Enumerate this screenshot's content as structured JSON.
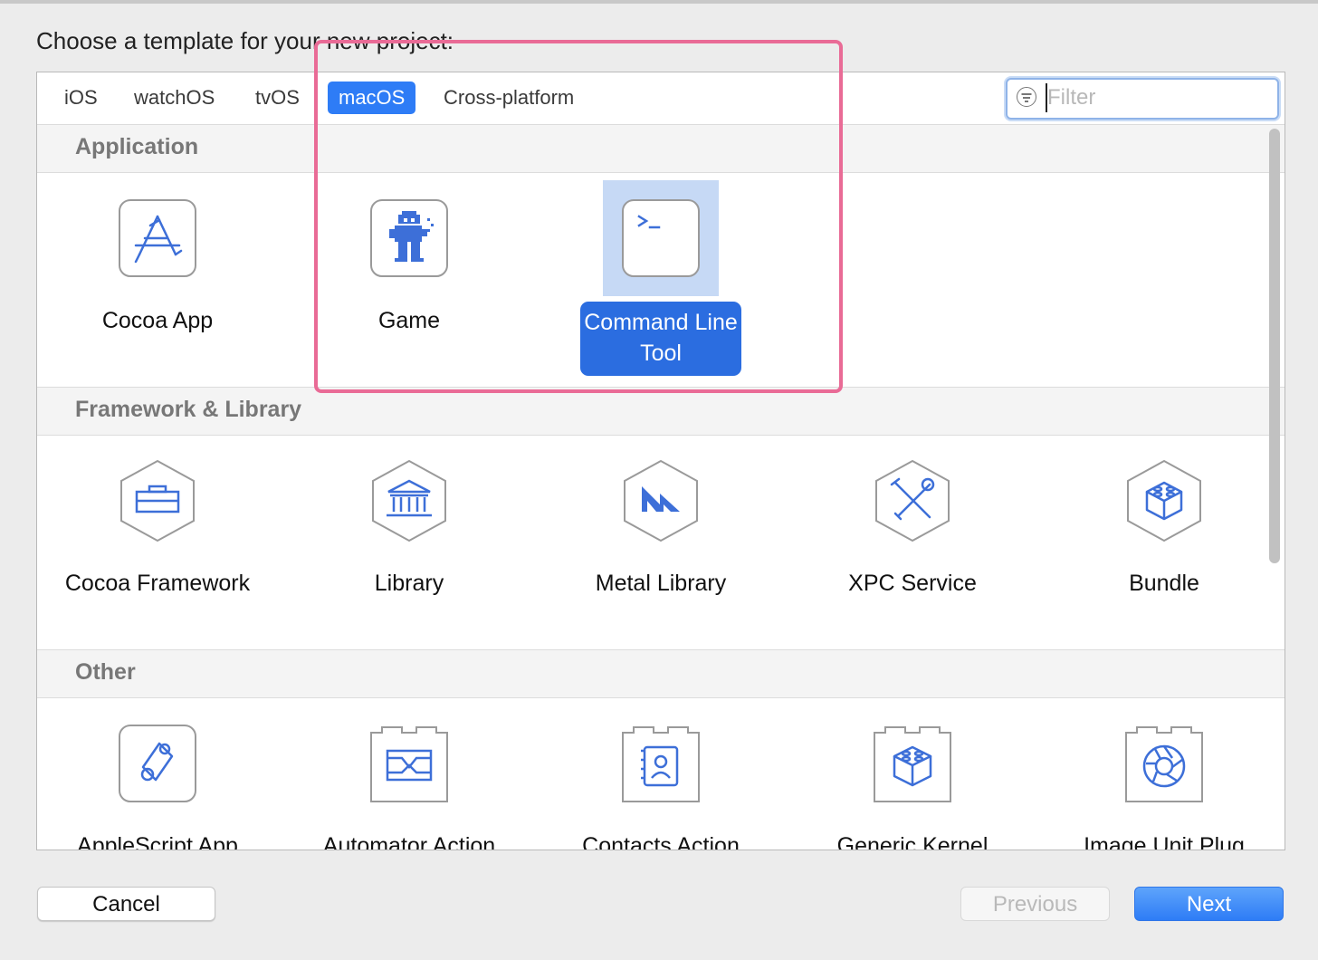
{
  "dialog": {
    "heading": "Choose a template for your new project:"
  },
  "tabs": [
    {
      "label": "iOS"
    },
    {
      "label": "watchOS"
    },
    {
      "label": "tvOS"
    },
    {
      "label": "macOS",
      "active": true
    },
    {
      "label": "Cross-platform"
    }
  ],
  "filter": {
    "placeholder": "Filter",
    "value": ""
  },
  "sections": [
    {
      "title": "Application",
      "items": [
        {
          "label": "Cocoa App",
          "icon": "app-store-icon"
        },
        {
          "label": "Game",
          "icon": "game-sprite-icon"
        },
        {
          "label": "Command Line Tool",
          "icon": "terminal-icon",
          "selected": true
        }
      ]
    },
    {
      "title": "Framework & Library",
      "items": [
        {
          "label": "Cocoa Framework",
          "icon": "toolbox-icon"
        },
        {
          "label": "Library",
          "icon": "building-icon"
        },
        {
          "label": "Metal Library",
          "icon": "metal-icon"
        },
        {
          "label": "XPC Service",
          "icon": "tools-icon"
        },
        {
          "label": "Bundle",
          "icon": "lego-block-icon"
        }
      ]
    },
    {
      "title": "Other",
      "items": [
        {
          "label": "AppleScript App",
          "icon": "script-icon"
        },
        {
          "label": "Automator Action",
          "icon": "automator-icon"
        },
        {
          "label": "Contacts Action",
          "icon": "contacts-icon"
        },
        {
          "label": "Generic Kernel",
          "icon": "kernel-block-icon"
        },
        {
          "label": "Image Unit Plug",
          "icon": "aperture-icon"
        }
      ]
    }
  ],
  "buttons": {
    "cancel": "Cancel",
    "previous": "Previous",
    "next": "Next"
  },
  "colors": {
    "accent": "#2e7cf6",
    "icon_stroke": "#3d6fd8",
    "highlight_box": "#e96b96"
  }
}
